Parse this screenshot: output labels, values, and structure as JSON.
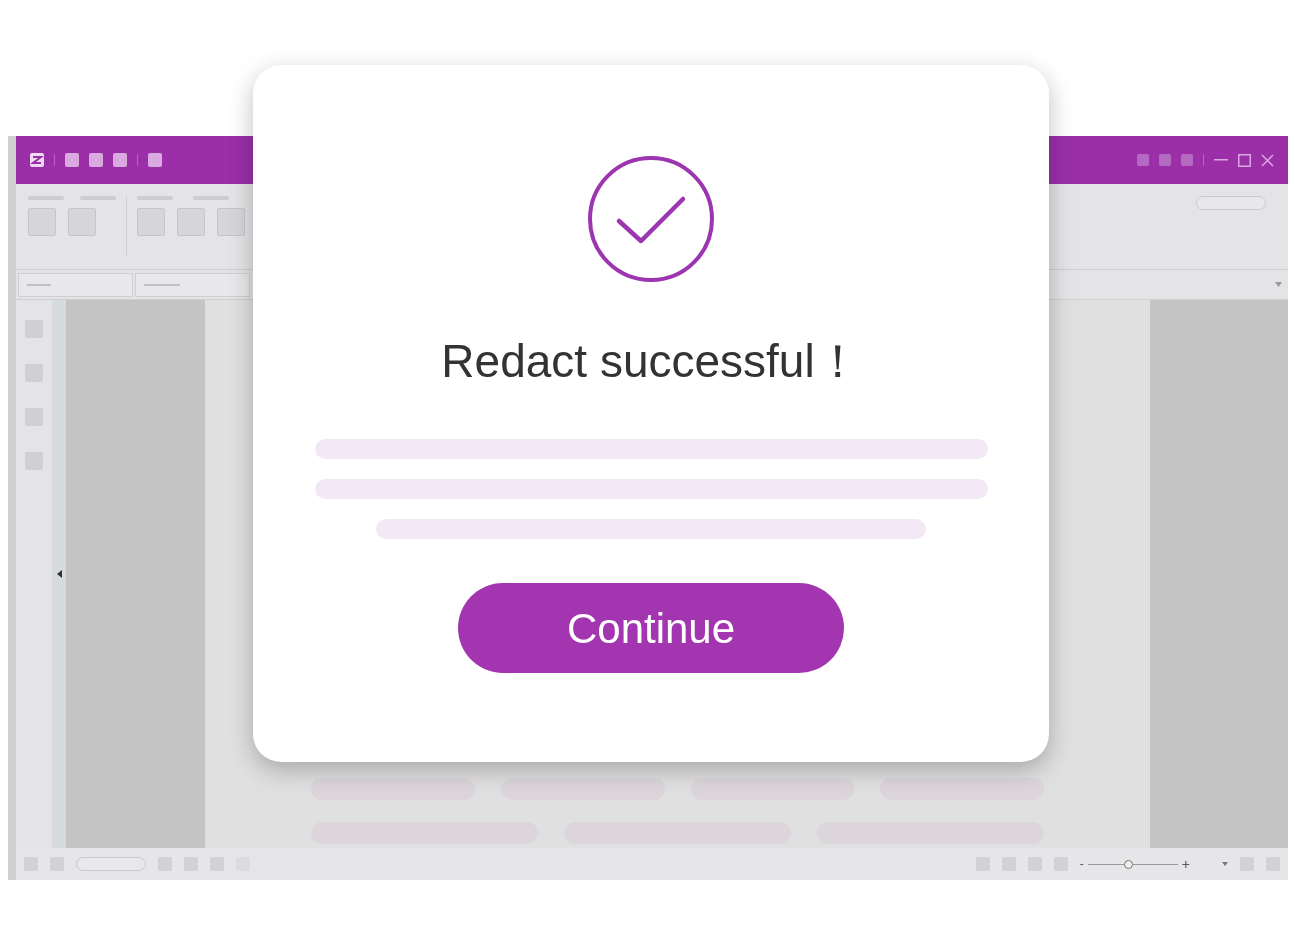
{
  "dialog": {
    "title": "Redact successful！",
    "button": "Continue"
  },
  "zoom_slider": {
    "level": 0.45,
    "minus": "-",
    "plus": "+"
  }
}
